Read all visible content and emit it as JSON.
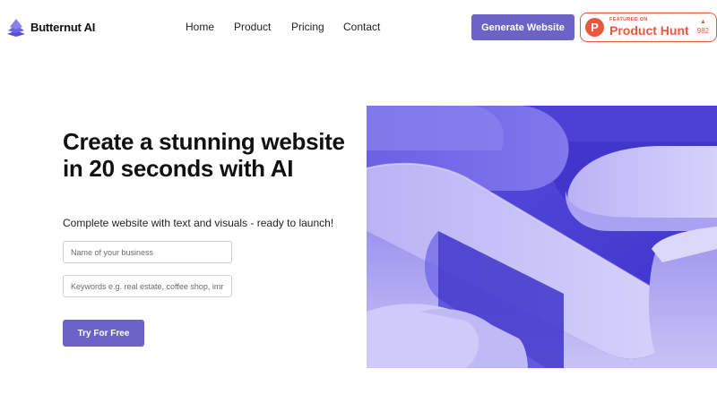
{
  "header": {
    "logo_text": "Butternut AI",
    "nav": [
      "Home",
      "Product",
      "Pricing",
      "Contact"
    ],
    "cta_label": "Generate Website",
    "product_hunt": {
      "small": "FEATURED ON",
      "big": "Product Hunt",
      "letter": "P",
      "votes": "982"
    }
  },
  "hero": {
    "title": "Create a stunning website in 20 seconds with AI",
    "subtitle": "Complete website with text and visuals - ready to launch!",
    "business_placeholder": "Name of your business",
    "keywords_placeholder": "Keywords e.g. real estate, coffee shop, imr",
    "try_label": "Try For Free"
  },
  "colors": {
    "accent": "#6b63c6",
    "product_hunt": "#e8583e",
    "art_dark": "#4a3fd6",
    "art_light": "#c9c4f3"
  }
}
